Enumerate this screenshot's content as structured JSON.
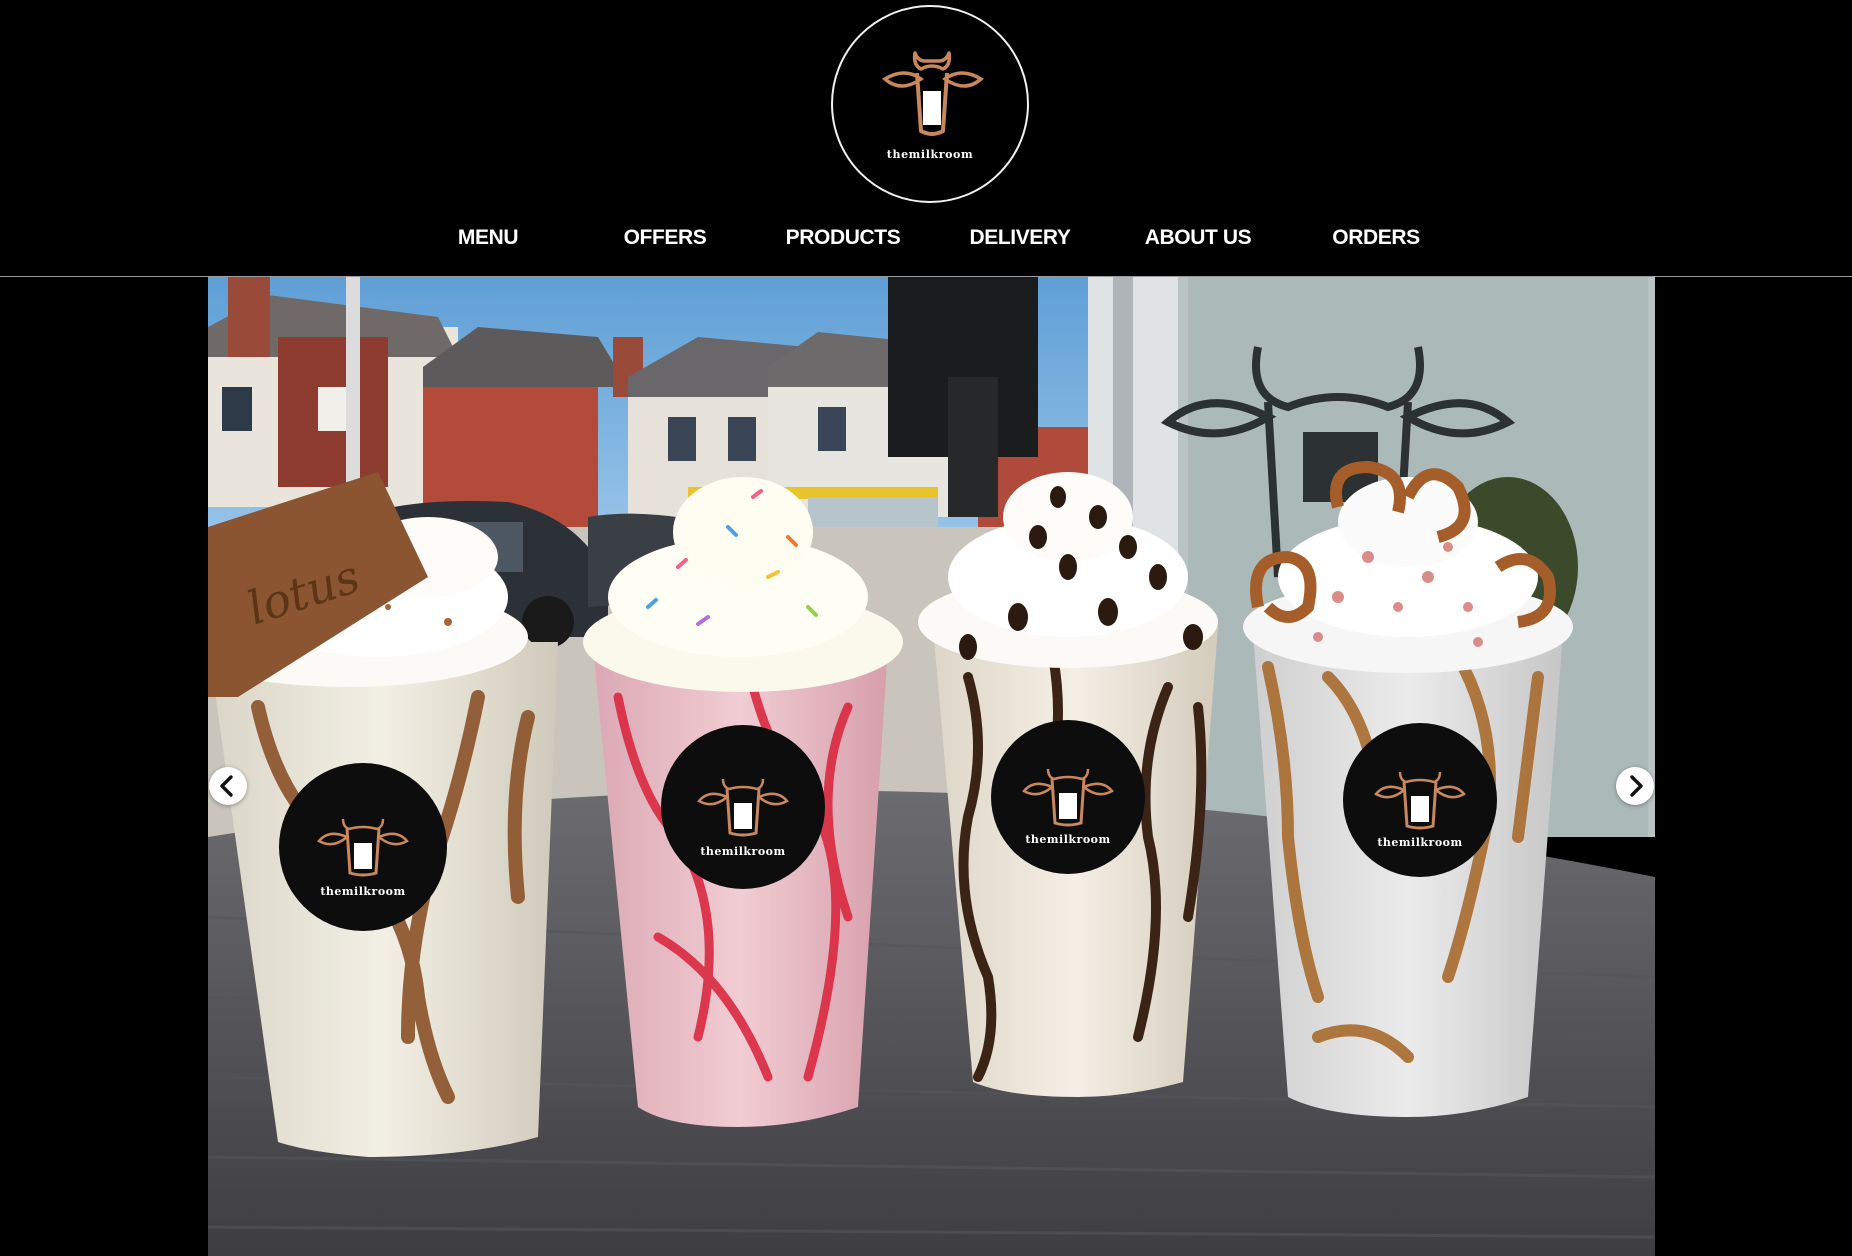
{
  "brand": {
    "name": "themilkroom",
    "accent_color": "#c9875e",
    "logo_icon": "cow-milk-glass-icon"
  },
  "nav": {
    "items": [
      {
        "label": "MENU"
      },
      {
        "label": "OFFERS"
      },
      {
        "label": "PRODUCTS"
      },
      {
        "label": "DELIVERY"
      },
      {
        "label": "ABOUT US"
      },
      {
        "label": "ORDERS"
      }
    ]
  },
  "hero": {
    "biscuit_text": "lotus",
    "sticker_text": "themilkroom",
    "prev_icon": "chevron-left-icon",
    "next_icon": "chevron-right-icon"
  }
}
